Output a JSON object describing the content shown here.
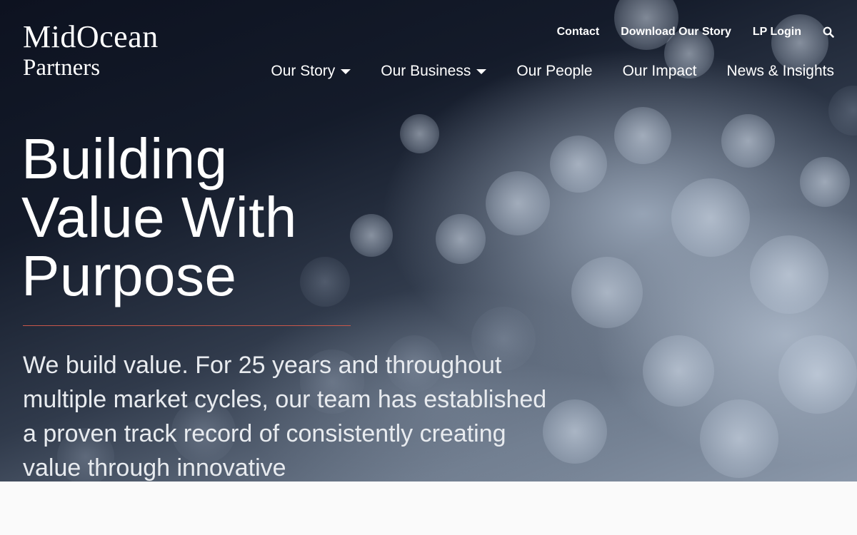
{
  "brand": {
    "line1": "MidOcean",
    "line2": "Partners"
  },
  "utility_nav": {
    "contact": "Contact",
    "download": "Download Our Story",
    "login": "LP Login",
    "search_icon": "search-icon"
  },
  "main_nav": {
    "items": [
      {
        "label": "Our Story",
        "dropdown": true
      },
      {
        "label": "Our Business",
        "dropdown": true
      },
      {
        "label": "Our People",
        "dropdown": false
      },
      {
        "label": "Our Impact",
        "dropdown": false
      },
      {
        "label": "News & Insights",
        "dropdown": false
      }
    ]
  },
  "hero": {
    "headline_lines": [
      "Building",
      "Value With",
      "Purpose"
    ],
    "lede": "We build value. For 25 years and throughout multiple market cycles, our team has established a proven track record of consistently creating value through innovative"
  },
  "colors": {
    "accent_rule": "#c9574a",
    "text": "#ffffff"
  }
}
